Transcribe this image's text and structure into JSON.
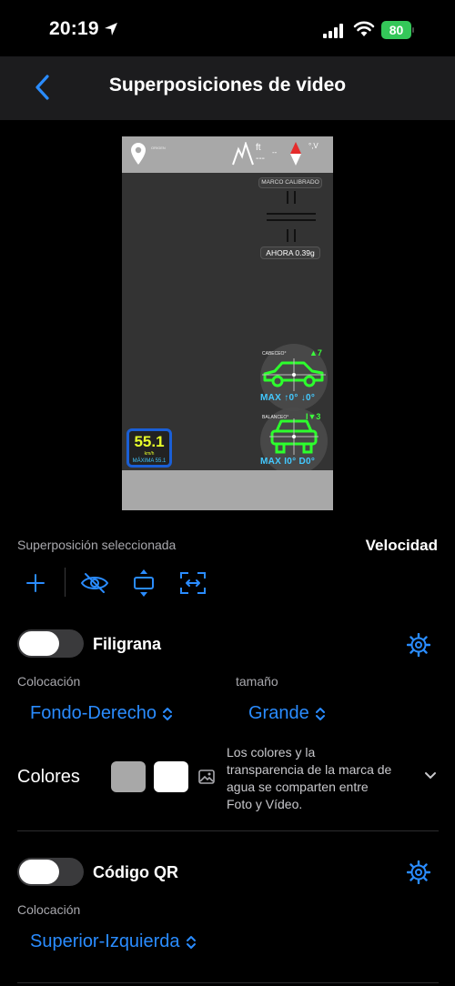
{
  "status": {
    "time": "20:19",
    "battery": "80"
  },
  "nav": {
    "title": "Superposiciones de video"
  },
  "preview": {
    "loc_small": "ORIGEN",
    "alt_unit": "ft",
    "alt_value": "---",
    "alt_dash": "--",
    "compass_unit": "°,V",
    "marco": "MARCO CALIBRADO",
    "ahora": "AHORA 0.39g",
    "pitch": {
      "label": "CABECEO°",
      "value": "▲7",
      "max": "MAX ↑0° ↓0°"
    },
    "roll": {
      "label": "BALANCEO°",
      "value": "I▼3",
      "max": "MAX I0° D0°"
    },
    "speed": {
      "value": "55.1",
      "unit": "km/h",
      "max": "MÁXIMA 55.1"
    }
  },
  "selected": {
    "label": "Superposición seleccionada",
    "value": "Velocidad"
  },
  "watermark": {
    "title": "Filigrana",
    "placement_label": "Colocación",
    "placement_value": "Fondo-Derecho",
    "size_label": "tamaño",
    "size_value": "Grande",
    "colors_label": "Colores",
    "colors_note": [
      "Los colores y la",
      "transparencia de la marca de",
      "agua se comparten entre",
      "Foto y Vídeo."
    ],
    "swatch_colors": [
      "#a8a8a8",
      "#ffffff"
    ]
  },
  "qr": {
    "title": "Código QR",
    "placement_label": "Colocación",
    "placement_value": "Superior-Izquierda"
  },
  "colors": {
    "accent": "#2a8cff",
    "battery": "#34c759",
    "navbar": "#1c1c1e"
  }
}
